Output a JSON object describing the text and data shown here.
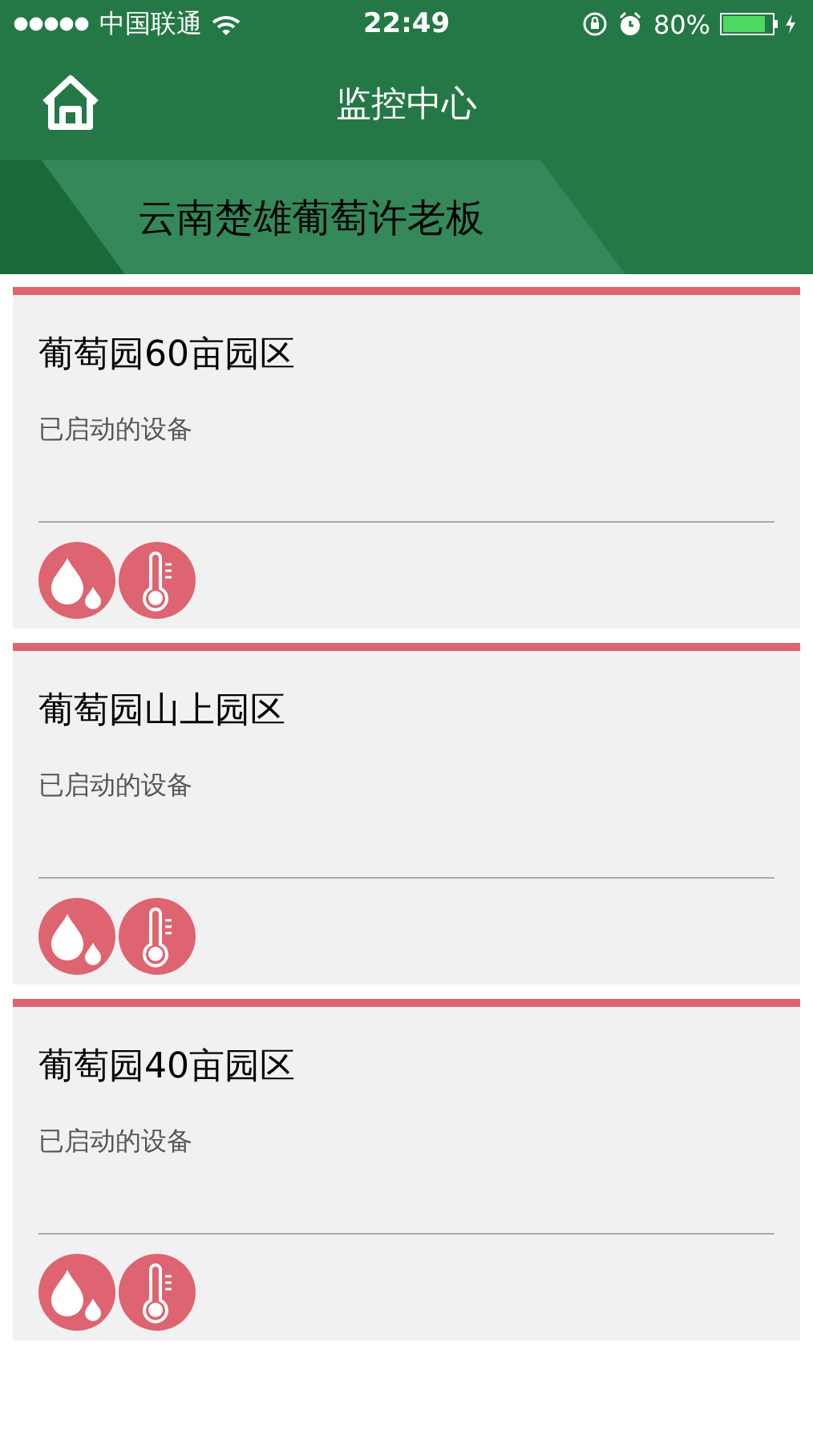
{
  "status_bar": {
    "carrier": "中国联通",
    "time": "22:49",
    "battery": "80%"
  },
  "nav": {
    "title": "监控中心"
  },
  "banner": {
    "title": "云南楚雄葡萄许老板"
  },
  "zones": [
    {
      "name": "葡萄园60亩园区",
      "subtitle": "已启动的设备",
      "devices": [
        {
          "kind": "humidity"
        },
        {
          "kind": "temperature"
        }
      ]
    },
    {
      "name": "葡萄园山上园区",
      "subtitle": "已启动的设备",
      "devices": [
        {
          "kind": "humidity"
        },
        {
          "kind": "temperature"
        }
      ]
    },
    {
      "name": "葡萄园40亩园区",
      "subtitle": "已启动的设备",
      "devices": [
        {
          "kind": "humidity"
        },
        {
          "kind": "temperature"
        }
      ]
    }
  ]
}
